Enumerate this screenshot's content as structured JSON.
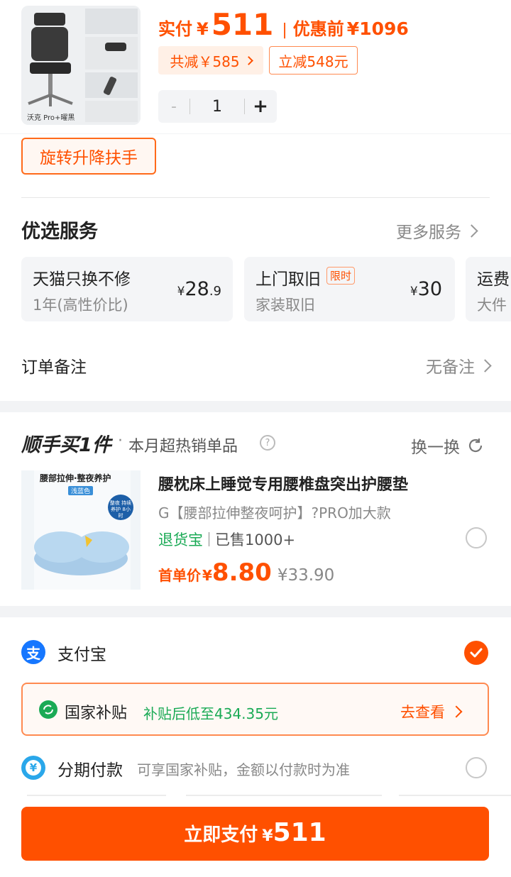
{
  "product": {
    "image_caption": "沃克 Pro+曜黑",
    "pay_label": "实付",
    "currency": "¥",
    "pay_price": "511",
    "separator": "|",
    "before_label": "优惠前",
    "before_price": "¥1096",
    "discount_total": "共减￥585",
    "instant_discount": "立减548元",
    "quantity": "1",
    "minus": "-",
    "plus": "+"
  },
  "option_chip": "旋转升降扶手",
  "services": {
    "title": "优选服务",
    "more": "更多服务",
    "cards": [
      {
        "title": "天猫只换不修",
        "subtitle": "1年(高性价比)",
        "currency": "¥",
        "price_int": "28",
        "price_dec": ".9"
      },
      {
        "title": "上门取旧",
        "badge": "限时",
        "subtitle": "家装取旧",
        "currency": "¥",
        "price_int": "30"
      },
      {
        "title": "运费",
        "subtitle": "大件"
      }
    ]
  },
  "order_note": {
    "label": "订单备注",
    "value": "无备注"
  },
  "addon": {
    "brand": "顺手买1件",
    "dot": "·",
    "subtitle": "本月超热销单品",
    "help": "?",
    "swap": "换一换",
    "image_texts": [
      "腰部拉伸·整夜养护",
      "浅蓝色",
      "整夜 持续养护 8小时"
    ],
    "title": "腰枕床上睡觉专用腰椎盘突出护腰垫",
    "spec": "G【腰部拉伸整夜呵护】?PRO加大款",
    "return_tag": "退货宝",
    "sold": "已售1000+",
    "first_label": "首单价",
    "currency": "¥",
    "first_price": "8.80",
    "orig_price": "¥33.90"
  },
  "payment": {
    "alipay": "支付宝",
    "subsidy_label": "国家补贴",
    "subsidy_text": "补贴后低至434.35元",
    "subsidy_link": "去查看",
    "installment": "分期付款",
    "installment_desc": "可享国家补贴，金额以付款时为准"
  },
  "submit": {
    "label": "立即支付",
    "currency": "¥",
    "amount": "511"
  },
  "colors": {
    "accent": "#ff5000",
    "green": "#1aaa55",
    "alipay_blue": "#1677ff"
  }
}
